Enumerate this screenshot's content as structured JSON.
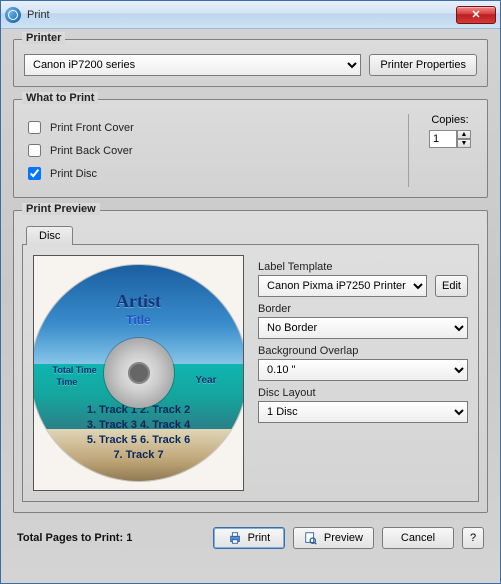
{
  "window": {
    "title": "Print"
  },
  "printer": {
    "legend": "Printer",
    "selected": "Canon iP7200 series",
    "properties_btn": "Printer Properties"
  },
  "what": {
    "legend": "What to Print",
    "front": "Print Front Cover",
    "back": "Print Back Cover",
    "disc": "Print Disc",
    "copies_label": "Copies:",
    "copies_value": "1"
  },
  "preview": {
    "legend": "Print Preview",
    "tab": "Disc",
    "disc": {
      "artist": "Artist",
      "title": "Title",
      "total_time_label": "Total Time",
      "time_label": "Time",
      "year_label": "Year",
      "tracks_row1": "1. Track 1   2. Track 2",
      "tracks_row2": "3. Track 3   4. Track 4",
      "tracks_row3": "5. Track 5   6. Track 6",
      "tracks_row4": "7. Track 7"
    },
    "side": {
      "label_template_label": "Label Template",
      "label_template_value": "Canon Pixma iP7250 Printer",
      "edit_btn": "Edit",
      "border_label": "Border",
      "border_value": "No Border",
      "overlap_label": "Background Overlap",
      "overlap_value": "0.10 \"",
      "layout_label": "Disc Layout",
      "layout_value": "1 Disc"
    }
  },
  "footer": {
    "pages": "Total Pages to Print: 1",
    "print_btn": "Print",
    "preview_btn": "Preview",
    "cancel_btn": "Cancel",
    "help_btn": "?"
  }
}
